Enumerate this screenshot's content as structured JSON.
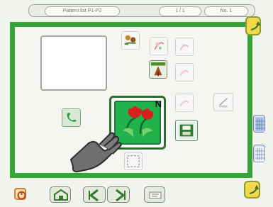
{
  "top_bar": {
    "left_label": "Pattern list P1-P2",
    "center_label": "1 / 1",
    "right_label": "No. 1"
  },
  "selected_pattern": {
    "badge": "N"
  },
  "footer": {
    "accent_color": "#37a43a",
    "selected_tile_color": "#22b24c"
  }
}
